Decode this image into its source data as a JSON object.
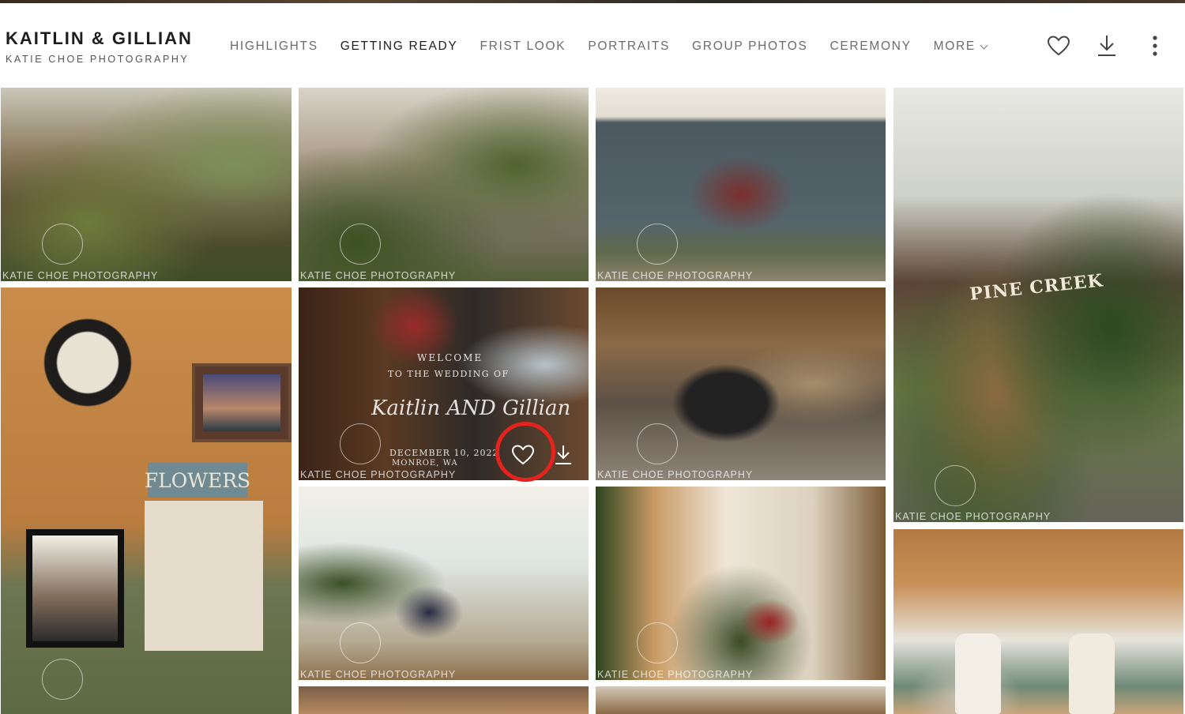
{
  "gallery": {
    "title": "KAITLIN & GILLIAN",
    "photographer": "KATIE CHOE PHOTOGRAPHY"
  },
  "nav": {
    "items": [
      {
        "label": "HIGHLIGHTS",
        "active": false
      },
      {
        "label": "GETTING READY",
        "active": true
      },
      {
        "label": "FRIST LOOK",
        "active": false
      },
      {
        "label": "PORTRAITS",
        "active": false
      },
      {
        "label": "GROUP PHOTOS",
        "active": false
      },
      {
        "label": "CEREMONY",
        "active": false
      }
    ],
    "more_label": "MORE"
  },
  "toolbar": {
    "favorite_icon": "heart-icon",
    "download_icon": "download-icon",
    "menu_icon": "more-vertical-icon"
  },
  "photos": {
    "watermark": "KATIE CHOE PHOTOGRAPHY",
    "hovered_photo_text": {
      "line1": "WELCOME",
      "line2": "TO THE WEDDING OF",
      "names": "Kaitlin AND Gillian",
      "date": "DECEMBER 10, 2022",
      "place": "MONROE, WA"
    },
    "sign_text_pine_creek": "PINE CREEK",
    "sign_text_flowers": "FLOWERS"
  },
  "colors": {
    "highlight_ring": "#e3231c",
    "active_nav": "#1d1d1d",
    "inactive_nav": "#6b6b6b"
  }
}
